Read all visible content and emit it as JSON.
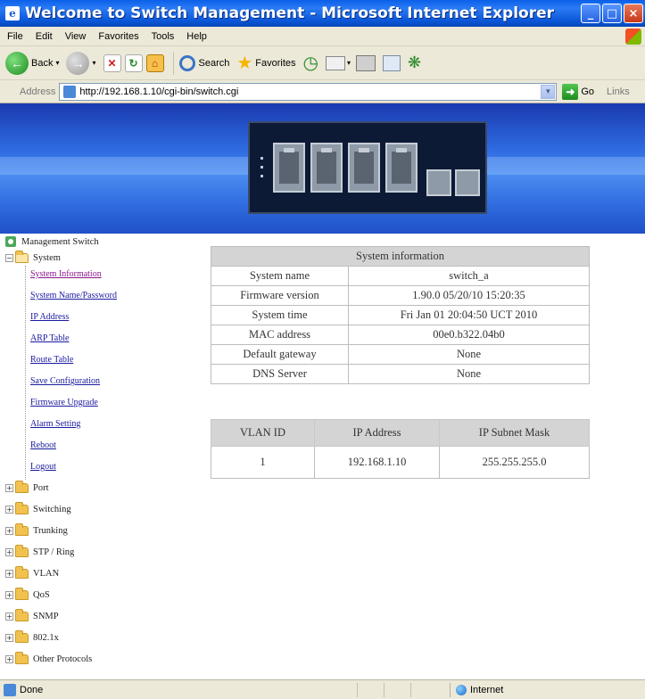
{
  "window": {
    "title": "Welcome to Switch Management - Microsoft Internet Explorer",
    "app_icon_glyph": "e"
  },
  "menubar": {
    "items": [
      "File",
      "Edit",
      "View",
      "Favorites",
      "Tools",
      "Help"
    ]
  },
  "toolbar": {
    "back_label": "Back",
    "search_label": "Search",
    "favorites_label": "Favorites"
  },
  "addressbar": {
    "label": "Address",
    "url": "http://192.168.1.10/cgi-bin/switch.cgi",
    "go_label": "Go",
    "links_label": "Links"
  },
  "tree": {
    "root_label": "Management Switch",
    "system_label": "System",
    "system_items": [
      "System Information",
      "System Name/Password",
      "IP Address",
      "ARP Table",
      "Route Table",
      "Save Configuration",
      "Firmware Upgrade",
      "Alarm Setting",
      "Reboot",
      "Logout"
    ],
    "folders": [
      "Port",
      "Switching",
      "Trunking",
      "STP / Ring",
      "VLAN",
      "QoS",
      "SNMP",
      "802.1x",
      "Other Protocols"
    ]
  },
  "system_info": {
    "header": "System information",
    "rows": [
      {
        "key": "System name",
        "value": "switch_a"
      },
      {
        "key": "Firmware version",
        "value": "1.90.0 05/20/10 15:20:35"
      },
      {
        "key": "System time",
        "value": "Fri Jan 01 20:04:50 UCT 2010"
      },
      {
        "key": "MAC address",
        "value": "00e0.b322.04b0"
      },
      {
        "key": "Default gateway",
        "value": "None"
      },
      {
        "key": "DNS Server",
        "value": "None"
      }
    ]
  },
  "vlan_table": {
    "headers": [
      "VLAN ID",
      "IP Address",
      "IP Subnet Mask"
    ],
    "rows": [
      [
        "1",
        "192.168.1.10",
        "255.255.255.0"
      ]
    ]
  },
  "statusbar": {
    "status_text": "Done",
    "zone_text": "Internet"
  },
  "colors": {
    "titlebar_blue": "#0a5fe8",
    "banner_blue": "#2e6ae0",
    "link_blue": "#1a1aa0",
    "visited_purple": "#8a1a8a",
    "table_header_grey": "#d4d4d4"
  }
}
